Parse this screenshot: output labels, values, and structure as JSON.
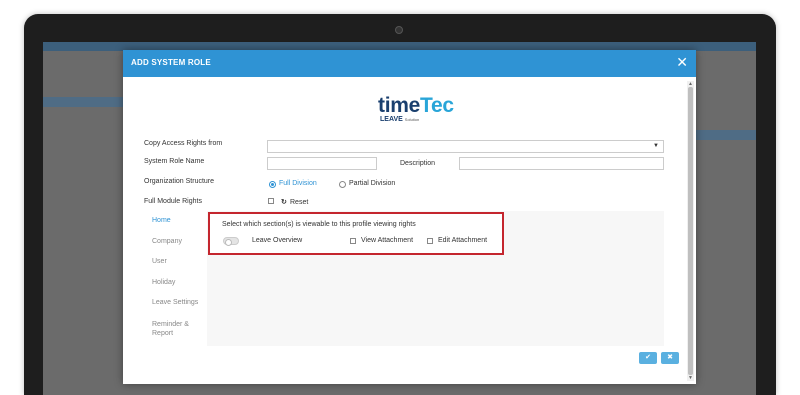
{
  "modal": {
    "title": "ADD SYSTEM ROLE",
    "close_icon": "close-icon"
  },
  "logo": {
    "time": "time",
    "tec": "Tec",
    "leave": "LEAVE",
    "solution": "Solution"
  },
  "form": {
    "copy_access_label": "Copy Access Rights from",
    "copy_access_value": "",
    "system_role_label": "System Role Name",
    "system_role_value": "",
    "description_label": "Description",
    "description_value": "",
    "org_structure_label": "Organization Structure",
    "full_division": "Full Division",
    "partial_division": "Partial Division",
    "org_structure_selected": "Full Division",
    "full_module_label": "Full Module Rights",
    "reset_label": "Reset"
  },
  "tabs": [
    "Home",
    "Company",
    "User",
    "Holiday",
    "Leave Settings",
    "Reminder & Report"
  ],
  "active_tab": "Home",
  "home_panel": {
    "instruction": "Select which section(s) is viewable to this profile viewing rights",
    "leave_overview": "Leave Overview",
    "view_attachment": "View Attachment",
    "edit_attachment": "Edit Attachment"
  },
  "footer": {
    "confirm_icon": "check-icon",
    "cancel_icon": "close-icon"
  },
  "colors": {
    "header": "#2f93d4",
    "highlight_border": "#c4262e",
    "button": "#5ab0e0"
  }
}
